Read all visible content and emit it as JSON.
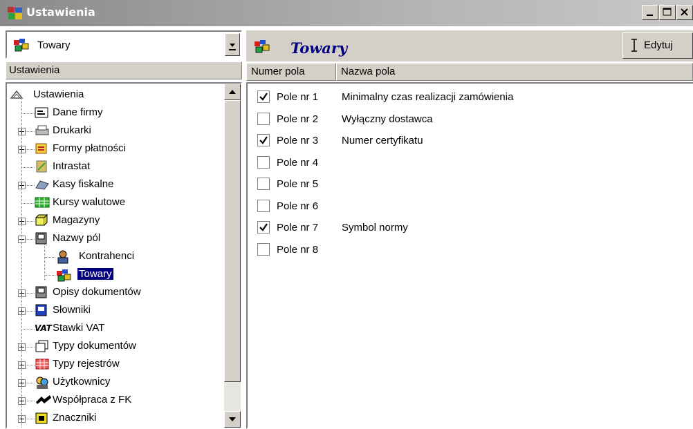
{
  "window": {
    "title": "Ustawienia",
    "buttons": [
      "minimize",
      "maximize",
      "close"
    ]
  },
  "left_panel": {
    "combo_value": "Towary",
    "header": "Ustawienia",
    "tree": [
      {
        "label": "Ustawienia",
        "icon": "settings-root-icon",
        "level": 0,
        "expander": "none"
      },
      {
        "label": "Dane firmy",
        "icon": "company-card-icon",
        "level": 1,
        "expander": "none"
      },
      {
        "label": "Drukarki",
        "icon": "printer-icon",
        "level": 1,
        "expander": "plus"
      },
      {
        "label": "Formy płatności",
        "icon": "payment-icon",
        "level": 1,
        "expander": "plus"
      },
      {
        "label": "Intrastat",
        "icon": "intrastat-icon",
        "level": 1,
        "expander": "none"
      },
      {
        "label": "Kasy fiskalne",
        "icon": "cash-register-icon",
        "level": 1,
        "expander": "plus"
      },
      {
        "label": "Kursy walutowe",
        "icon": "currency-grid-icon",
        "level": 1,
        "expander": "none"
      },
      {
        "label": "Magazyny",
        "icon": "warehouse-icon",
        "level": 1,
        "expander": "plus"
      },
      {
        "label": "Nazwy pól",
        "icon": "field-names-icon",
        "level": 1,
        "expander": "minus"
      },
      {
        "label": "Kontrahenci",
        "icon": "contractor-icon",
        "level": 2,
        "expander": "none"
      },
      {
        "label": "Towary",
        "icon": "goods-icon",
        "level": 2,
        "expander": "none",
        "selected": true
      },
      {
        "label": "Opisy dokumentów",
        "icon": "document-desc-icon",
        "level": 1,
        "expander": "plus"
      },
      {
        "label": "Słowniki",
        "icon": "dictionary-icon",
        "level": 1,
        "expander": "plus"
      },
      {
        "label": "Stawki VAT",
        "icon": "vat-icon",
        "level": 1,
        "expander": "none"
      },
      {
        "label": "Typy dokumentów",
        "icon": "document-types-icon",
        "level": 1,
        "expander": "plus"
      },
      {
        "label": "Typy rejestrów",
        "icon": "register-types-icon",
        "level": 1,
        "expander": "plus"
      },
      {
        "label": "Użytkownicy",
        "icon": "users-icon",
        "level": 1,
        "expander": "plus"
      },
      {
        "label": "Współpraca z FK",
        "icon": "fk-cooperation-icon",
        "level": 1,
        "expander": "plus"
      },
      {
        "label": "Znaczniki",
        "icon": "markers-icon",
        "level": 1,
        "expander": "plus"
      }
    ]
  },
  "right_panel": {
    "title": "Towary",
    "edit_button": "Edytuj",
    "columns": [
      "Numer pola",
      "Nazwa pola"
    ],
    "rows": [
      {
        "checked": true,
        "number": "Pole nr 1",
        "name": "Minimalny czas realizacji zamówienia"
      },
      {
        "checked": false,
        "number": "Pole nr 2",
        "name": "Wyłączny dostawca"
      },
      {
        "checked": true,
        "number": "Pole nr 3",
        "name": "Numer certyfikatu"
      },
      {
        "checked": false,
        "number": "Pole nr 4",
        "name": ""
      },
      {
        "checked": false,
        "number": "Pole nr 5",
        "name": ""
      },
      {
        "checked": false,
        "number": "Pole nr 6",
        "name": ""
      },
      {
        "checked": true,
        "number": "Pole nr 7",
        "name": "Symbol normy"
      },
      {
        "checked": false,
        "number": "Pole nr 8",
        "name": ""
      }
    ]
  }
}
